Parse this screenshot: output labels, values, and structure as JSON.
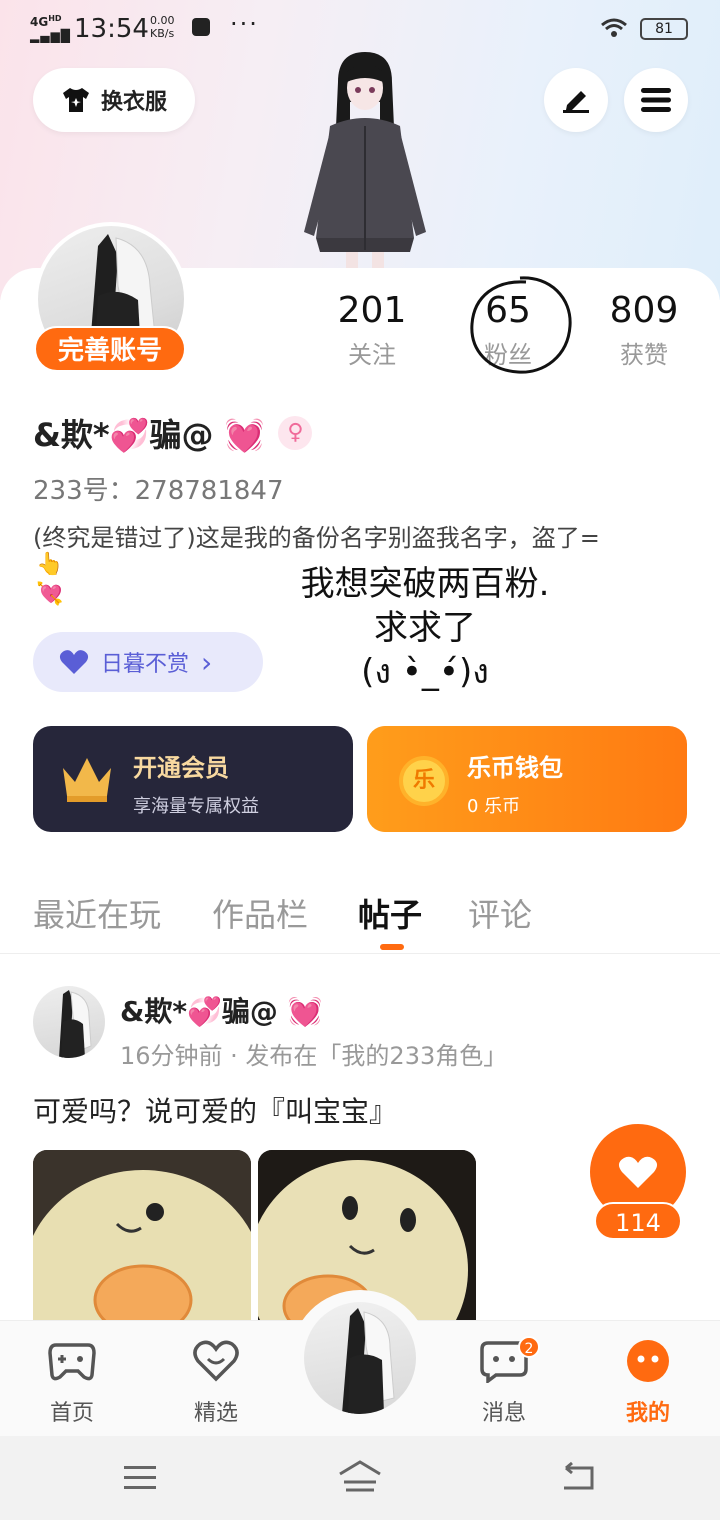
{
  "status_bar": {
    "network": "4G",
    "network_sub": "HD",
    "time": "13:54",
    "speed_value": "0.00",
    "speed_unit": "KB/s",
    "more": "···",
    "battery": "81"
  },
  "header": {
    "dress_button_label": "换衣服",
    "edit_icon": "pencil-icon",
    "menu_icon": "hamburger-icon"
  },
  "profile": {
    "complete_account_label": "完善账号",
    "stats": [
      {
        "value": "201",
        "label": "关注"
      },
      {
        "value": "65",
        "label": "粉丝"
      },
      {
        "value": "809",
        "label": "获赞"
      }
    ],
    "username": "&欺*💞骗@ 💓",
    "gender_symbol": "♀",
    "uid": "233号：278781847",
    "bio": "(终究是错过了)这是我的备份名字别盗我名字，盗了=",
    "bio_line2": "👆",
    "bio_line3": "💘",
    "tag_label": "日暮不赏",
    "tag_arrow": "›"
  },
  "overlay_text": {
    "line1": "我想突破两百粉.",
    "line2": "求求了",
    "line3": "(ง •̀_•́)ง"
  },
  "cards": {
    "vip": {
      "title": "开通会员",
      "subtitle": "享海量专属权益"
    },
    "wallet": {
      "title": "乐币钱包",
      "subtitle": "0 乐币",
      "coin_glyph": "乐"
    }
  },
  "tabs": [
    {
      "label": "最近在玩",
      "active": false
    },
    {
      "label": "作品栏",
      "active": false
    },
    {
      "label": "帖子",
      "active": true
    },
    {
      "label": "评论",
      "active": false
    }
  ],
  "post": {
    "author": "&欺*💞骗@ 💓",
    "meta": "16分钟前 · 发布在「我的233角色」",
    "text": "可爱吗？说可爱的『叫宝宝』",
    "like_count": "114"
  },
  "bottom_nav": [
    {
      "label": "首页",
      "icon": "gamepad-icon",
      "active": false
    },
    {
      "label": "精选",
      "icon": "heart-smile-icon",
      "active": false
    },
    {
      "label": "消息",
      "icon": "chat-icon",
      "active": false,
      "badge": "2"
    },
    {
      "label": "我的",
      "icon": "face-icon",
      "active": true
    }
  ],
  "colors": {
    "accent": "#ff6a10",
    "vip_bg": "#26263a",
    "tag_text": "#5a5ed6"
  }
}
